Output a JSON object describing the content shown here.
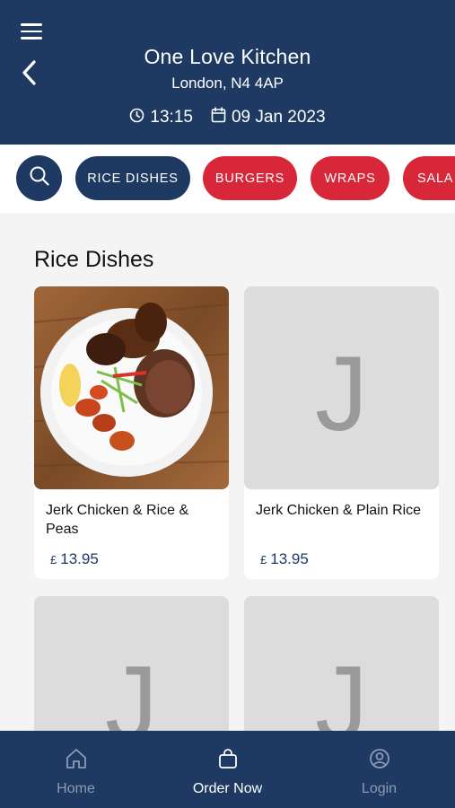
{
  "header": {
    "title": "One Love Kitchen",
    "location": "London, N4 4AP",
    "time": "13:15",
    "date": "09 Jan 2023",
    "icons": [
      "menu-icon",
      "back-icon",
      "clock-icon",
      "calendar-icon"
    ]
  },
  "categories": {
    "items": [
      {
        "label": "RICE DISHES",
        "active": true
      },
      {
        "label": "BURGERS",
        "active": false
      },
      {
        "label": "WRAPS",
        "active": false
      },
      {
        "label": "SALA",
        "active": false
      }
    ],
    "search_icon": "search-icon"
  },
  "section": {
    "title": "Rice Dishes"
  },
  "products": [
    {
      "name": "Jerk Chicken & Rice & Peas",
      "currency": "£",
      "price": "13.95",
      "has_photo": true
    },
    {
      "name": "Jerk Chicken & Plain Rice",
      "currency": "£",
      "price": "13.95",
      "placeholder_letter": "J"
    },
    {
      "name": "",
      "currency": "",
      "price": "",
      "placeholder_letter": "J"
    },
    {
      "name": "",
      "currency": "",
      "price": "",
      "placeholder_letter": "J"
    }
  ],
  "tabbar": {
    "items": [
      {
        "label": "Home",
        "icon": "home-icon",
        "active": false
      },
      {
        "label": "Order Now",
        "icon": "bag-icon",
        "active": true
      },
      {
        "label": "Login",
        "icon": "user-icon",
        "active": false
      }
    ]
  },
  "colors": {
    "primary": "#1e3a62",
    "accent_red": "#d9273a",
    "placeholder": "#dcdcdc"
  }
}
